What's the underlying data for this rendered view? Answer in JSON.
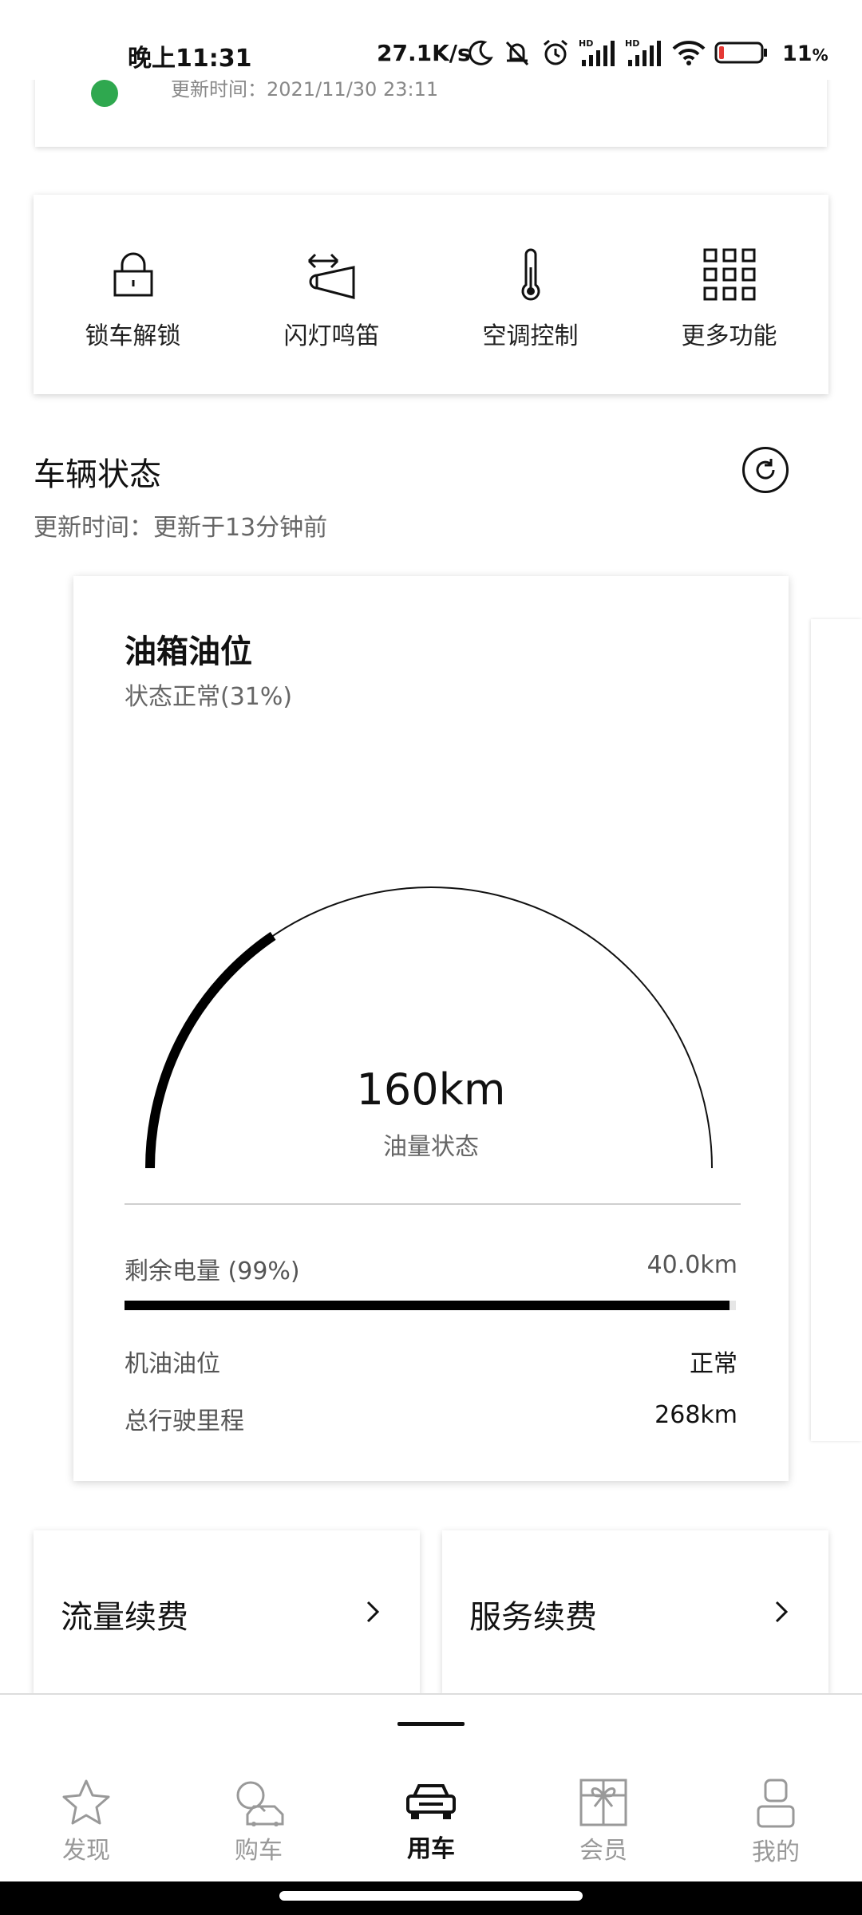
{
  "status_bar": {
    "time": "晚上11:31",
    "net_speed": "27.1K/s",
    "icons": [
      "moon-icon",
      "mute-icon",
      "alarm-icon",
      "signal-hd-1-icon",
      "signal-hd-2-icon",
      "wifi-icon",
      "battery-icon"
    ],
    "battery_pct": "11",
    "battery_color": "#e53935"
  },
  "top_card": {
    "update_time": "更新时间：2021/11/30 23:11"
  },
  "quick_actions": [
    {
      "label": "锁车解锁",
      "icon": "lock-icon"
    },
    {
      "label": "闪灯鸣笛",
      "icon": "flash-horn-icon"
    },
    {
      "label": "空调控制",
      "icon": "thermometer-icon"
    },
    {
      "label": "更多功能",
      "icon": "grid-icon"
    }
  ],
  "vehicle_status": {
    "title": "车辆状态",
    "update_info": "更新时间：更新于13分钟前"
  },
  "fuel_card": {
    "title": "油箱油位",
    "status": "状态正常(31%)",
    "fuel_level": 0.31,
    "range_value": "160km",
    "range_label": "油量状态",
    "electric_label": "剩余电量 (99%)",
    "electric_value": "40.0km",
    "electric_level": 0.99,
    "oil_label": "机油油位",
    "oil_value": "正常",
    "mileage_label": "总行驶里程",
    "mileage_value": "268km"
  },
  "renew": {
    "data_label": "流量续费",
    "service_label": "服务续费"
  },
  "tabbar": [
    {
      "label": "发现",
      "icon": "star-icon",
      "active": false
    },
    {
      "label": "购车",
      "icon": "car-search-icon",
      "active": false
    },
    {
      "label": "用车",
      "icon": "car-icon",
      "active": true
    },
    {
      "label": "会员",
      "icon": "gift-icon",
      "active": false
    },
    {
      "label": "我的",
      "icon": "person-icon",
      "active": false
    }
  ]
}
